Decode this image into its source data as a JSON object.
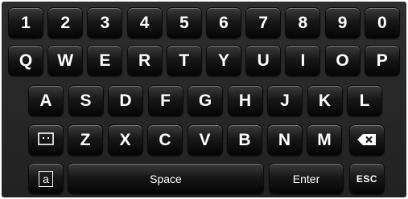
{
  "keyboard": {
    "row1": [
      "1",
      "2",
      "3",
      "4",
      "5",
      "6",
      "7",
      "8",
      "9",
      "0"
    ],
    "row2": [
      "Q",
      "W",
      "E",
      "R",
      "T",
      "Y",
      "U",
      "I",
      "O",
      "P"
    ],
    "row3": [
      "A",
      "S",
      "D",
      "F",
      "G",
      "H",
      "J",
      "K",
      "L"
    ],
    "row4": [
      "Z",
      "X",
      "C",
      "V",
      "B",
      "N",
      "M"
    ],
    "space_label": "Space",
    "enter_label": "Enter",
    "esc_label": "ESC",
    "caps_label": "a"
  }
}
